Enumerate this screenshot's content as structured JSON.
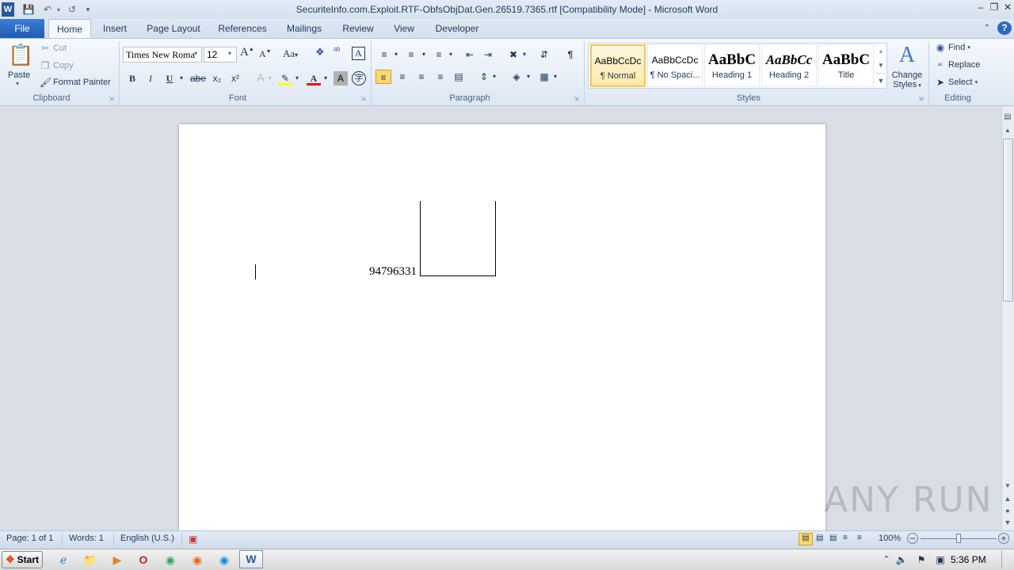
{
  "window": {
    "title": "SecuriteInfo.com.Exploit.RTF-ObfsObjDat.Gen.26519.7365.rtf [Compatibility Mode]  -  Microsoft Word",
    "app_icon": "W"
  },
  "tabs": {
    "file": "File",
    "items": [
      "Home",
      "Insert",
      "Page Layout",
      "References",
      "Mailings",
      "Review",
      "View",
      "Developer"
    ]
  },
  "clipboard": {
    "paste": "Paste",
    "cut": "Cut",
    "copy": "Copy",
    "format_painter": "Format Painter",
    "label": "Clipboard"
  },
  "font": {
    "name": "Times New Roma",
    "size": "12",
    "label": "Font",
    "bold": "B",
    "italic": "I",
    "underline": "U",
    "strike": "abe",
    "subscript": "x₂",
    "superscript": "x²",
    "grow": "A",
    "shrink": "A",
    "case": "Aa"
  },
  "paragraph": {
    "label": "Paragraph",
    "pilcrow": "¶"
  },
  "styles": {
    "label": "Styles",
    "items": [
      {
        "preview": "AaBbCcDc",
        "name": "¶ Normal"
      },
      {
        "preview": "AaBbCcDc",
        "name": "¶ No Spaci..."
      },
      {
        "preview": "AaBbC",
        "name": "Heading 1"
      },
      {
        "preview": "AaBbCc",
        "name": "Heading 2"
      },
      {
        "preview": "AaBbC",
        "name": "Title"
      }
    ],
    "change_styles_1": "Change",
    "change_styles_2": "Styles"
  },
  "editing": {
    "label": "Editing",
    "find": "Find",
    "replace": "Replace",
    "select": "Select"
  },
  "document": {
    "text": "94796331"
  },
  "watermark": "ANY RUN",
  "status": {
    "page": "Page: 1 of 1",
    "words": "Words: 1",
    "language": "English (U.S.)",
    "zoom": "100%"
  },
  "taskbar": {
    "start": "Start",
    "clock": "5:36 PM"
  },
  "colors": {
    "accent": "#2b579a",
    "file_tab": "#1f5bb5",
    "normal_style_border": "#f2c55c"
  }
}
